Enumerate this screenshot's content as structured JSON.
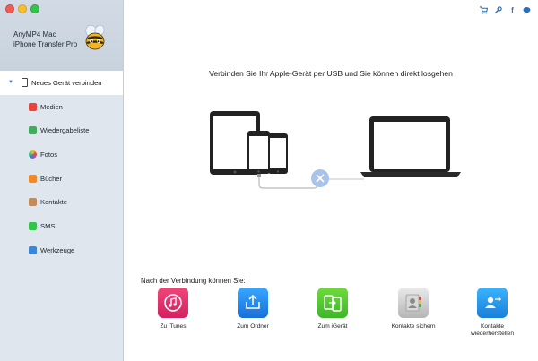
{
  "app": {
    "name_line1": "AnyMP4 Mac",
    "name_line2": "iPhone Transfer Pro"
  },
  "sidebar": {
    "items": [
      {
        "label": "Neues Gerät verbinden",
        "icon": "device-icon",
        "active": true
      },
      {
        "label": "Medien",
        "icon": "music-icon"
      },
      {
        "label": "Wiedergabeliste",
        "icon": "playlist-icon"
      },
      {
        "label": "Fotos",
        "icon": "photos-icon"
      },
      {
        "label": "Bücher",
        "icon": "books-icon"
      },
      {
        "label": "Kontakte",
        "icon": "contacts-icon"
      },
      {
        "label": "SMS",
        "icon": "sms-icon"
      },
      {
        "label": "Werkzeuge",
        "icon": "tools-icon"
      }
    ]
  },
  "toolbar": {
    "icons": [
      "cart-icon",
      "wrench-icon",
      "facebook-icon",
      "chat-icon"
    ]
  },
  "main": {
    "headline": "Verbinden Sie Ihr Apple-Gerät per USB und Sie können direkt losgehen",
    "after_connect_label": "Nach der Verbindung können Sie:",
    "actions": [
      {
        "label": "Zu iTunes",
        "icon": "itunes-icon"
      },
      {
        "label": "Zum Ordner",
        "icon": "folder-export-icon"
      },
      {
        "label": "Zum iGerät",
        "icon": "idevice-transfer-icon"
      },
      {
        "label": "Kontakte sichern",
        "icon": "contacts-backup-icon"
      },
      {
        "label": "Kontakte wiederherstellen",
        "icon": "contacts-restore-icon"
      }
    ]
  },
  "colors": {
    "accent": "#3a7bd5",
    "sidebar_bg": "#dfe6ee",
    "connector": "#a9c4ea"
  }
}
